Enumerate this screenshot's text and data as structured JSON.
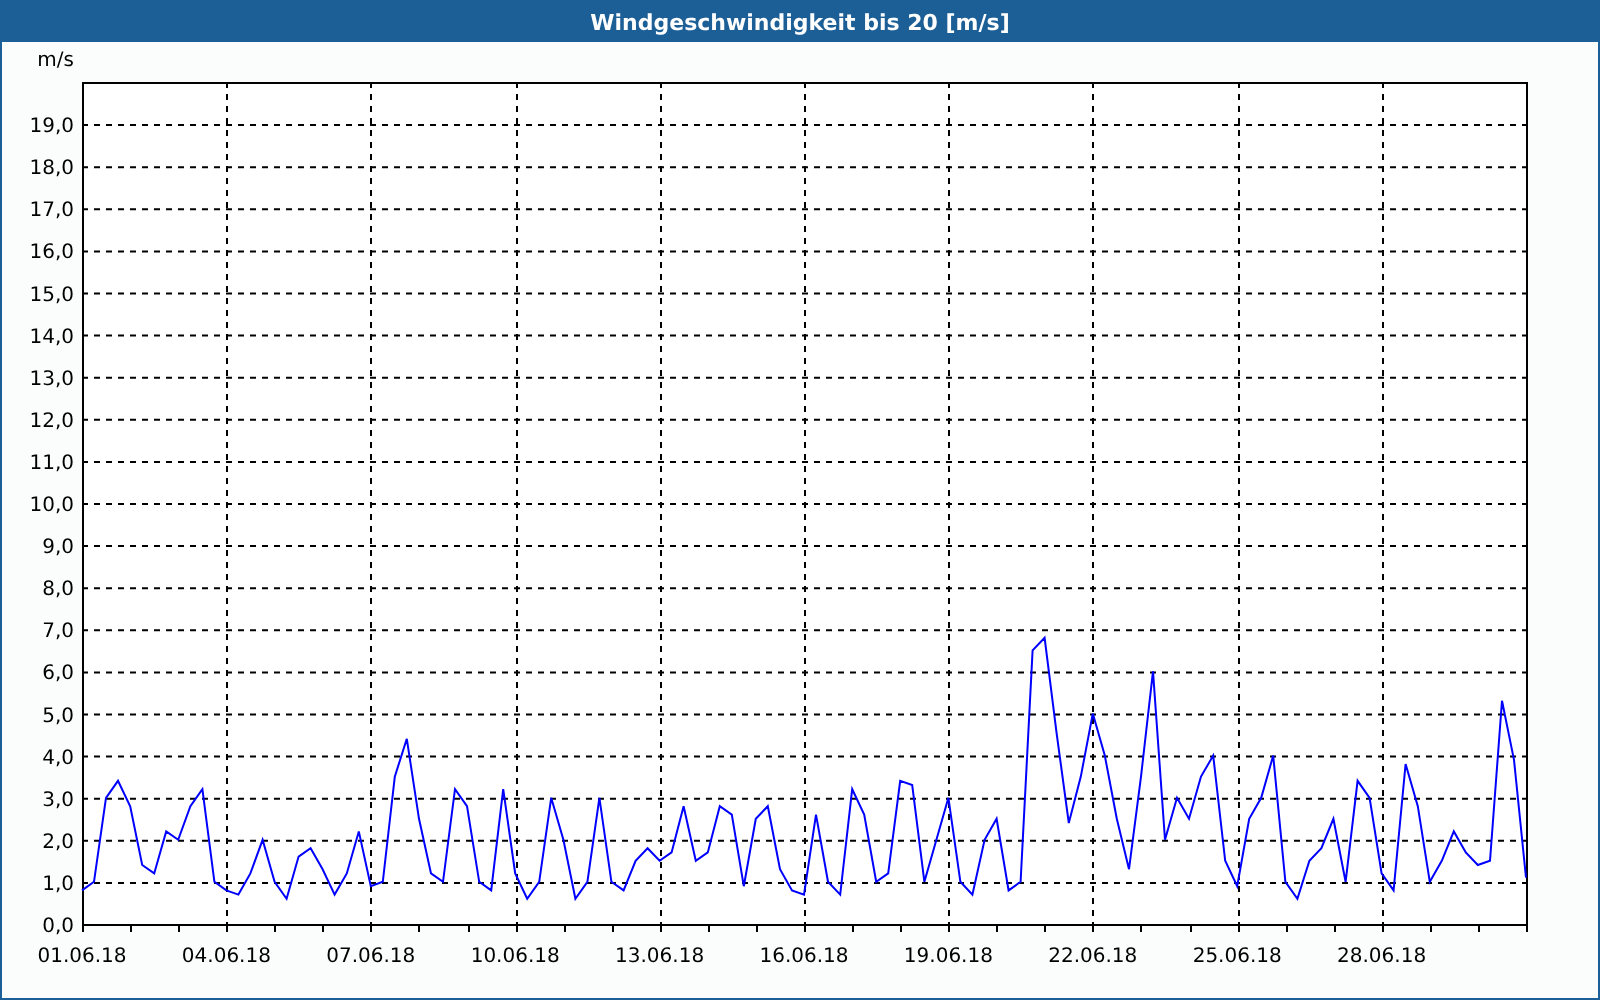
{
  "window": {
    "title": "Windgeschwindigkeit bis 20 [m/s]"
  },
  "chart": {
    "chart_data": {
      "type": "line",
      "grid": true,
      "ylabel": "m/s",
      "ylim": [
        0,
        20
      ],
      "yticks": [
        {
          "value": 0,
          "label": "0,0"
        },
        {
          "value": 1,
          "label": "1,0"
        },
        {
          "value": 2,
          "label": "2,0"
        },
        {
          "value": 3,
          "label": "3,0"
        },
        {
          "value": 4,
          "label": "4,0"
        },
        {
          "value": 5,
          "label": "5,0"
        },
        {
          "value": 6,
          "label": "6,0"
        },
        {
          "value": 7,
          "label": "7,0"
        },
        {
          "value": 8,
          "label": "8,0"
        },
        {
          "value": 9,
          "label": "9,0"
        },
        {
          "value": 10,
          "label": "10,0"
        },
        {
          "value": 11,
          "label": "11,0"
        },
        {
          "value": 12,
          "label": "12,0"
        },
        {
          "value": 13,
          "label": "13,0"
        },
        {
          "value": 14,
          "label": "14,0"
        },
        {
          "value": 15,
          "label": "15,0"
        },
        {
          "value": 16,
          "label": "16,0"
        },
        {
          "value": 17,
          "label": "17,0"
        },
        {
          "value": 18,
          "label": "18,0"
        },
        {
          "value": 19,
          "label": "19,0"
        }
      ],
      "categories": [
        "01.06.18",
        null,
        null,
        null,
        null,
        null,
        null,
        null,
        null,
        null,
        null,
        null,
        "04.06.18",
        null,
        null,
        null,
        null,
        null,
        null,
        null,
        null,
        null,
        null,
        null,
        "07.06.18",
        null,
        null,
        null,
        null,
        null,
        null,
        null,
        null,
        null,
        null,
        null,
        "10.06.18",
        null,
        null,
        null,
        null,
        null,
        null,
        null,
        null,
        null,
        null,
        null,
        "13.06.18",
        null,
        null,
        null,
        null,
        null,
        null,
        null,
        null,
        null,
        null,
        null,
        "16.06.18",
        null,
        null,
        null,
        null,
        null,
        null,
        null,
        null,
        null,
        null,
        null,
        "19.06.18",
        null,
        null,
        null,
        null,
        null,
        null,
        null,
        null,
        null,
        null,
        null,
        "22.06.18",
        null,
        null,
        null,
        null,
        null,
        null,
        null,
        null,
        null,
        null,
        null,
        "25.06.18",
        null,
        null,
        null,
        null,
        null,
        null,
        null,
        null,
        null,
        null,
        null,
        "28.06.18",
        null,
        null,
        null,
        null,
        null,
        null,
        null,
        null,
        null,
        null,
        null,
        null
      ],
      "series": [
        {
          "color": "#0000ff",
          "values": [
            0.8,
            1.0,
            3.0,
            3.4,
            2.8,
            1.4,
            1.2,
            2.2,
            2.0,
            2.8,
            3.2,
            1.0,
            0.8,
            0.7,
            1.2,
            2.0,
            1.0,
            0.6,
            1.6,
            1.8,
            1.3,
            0.7,
            1.2,
            2.2,
            0.9,
            1.0,
            3.5,
            4.4,
            2.5,
            1.2,
            1.0,
            3.2,
            2.8,
            1.0,
            0.8,
            3.2,
            1.2,
            0.6,
            1.0,
            3.0,
            2.0,
            0.6,
            1.0,
            3.0,
            1.0,
            0.8,
            1.5,
            1.8,
            1.5,
            1.7,
            2.8,
            1.5,
            1.7,
            2.8,
            2.6,
            0.9,
            2.5,
            2.8,
            1.3,
            0.8,
            0.7,
            2.6,
            1.0,
            0.7,
            3.2,
            2.6,
            1.0,
            1.2,
            3.4,
            3.3,
            1.0,
            2.0,
            3.0,
            1.0,
            0.7,
            2.0,
            2.5,
            0.8,
            1.0,
            6.5,
            6.8,
            4.5,
            2.4,
            3.5,
            5.0,
            4.0,
            2.5,
            1.3,
            3.5,
            6.0,
            2.0,
            3.0,
            2.5,
            3.5,
            4.0,
            1.5,
            0.9,
            2.5,
            3.0,
            4.0,
            1.0,
            0.6,
            1.5,
            1.8,
            2.5,
            1.0,
            3.4,
            3.0,
            1.2,
            0.8,
            3.8,
            2.8,
            1.0,
            1.5,
            2.2,
            1.7,
            1.4,
            1.5,
            5.3,
            3.9,
            1.1
          ]
        }
      ]
    }
  }
}
